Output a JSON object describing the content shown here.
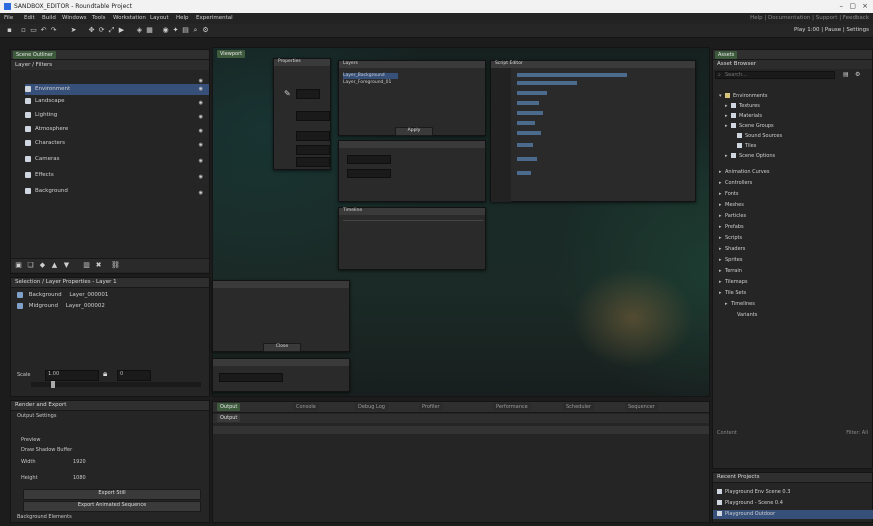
{
  "window": {
    "title": "SANDBOX_EDITOR - Roundtable Project"
  },
  "menu": [
    "File",
    "Edit",
    "Build",
    "Windows",
    "Tools",
    "Workstation",
    "Layout",
    "Help",
    "Experimental"
  ],
  "menu_right": "Help | Documentation | Support | Feedback",
  "toolbar": {
    "right_text": "Play 1:00 | Pause | Settings"
  },
  "scene_panel": {
    "tab": "Scene Outliner",
    "header": "Layer / Filters",
    "items": [
      "Environment",
      "Landscape",
      "Lighting",
      "Atmosphere",
      "Characters",
      "Cameras",
      "Effects",
      "Background"
    ],
    "selected_index": 0
  },
  "props_panel": {
    "title": "Selection / Layer Properties - Layer 1",
    "rows": [
      {
        "name": "Background",
        "value": "Layer_000001"
      },
      {
        "name": "Midground",
        "value": "Layer_000002"
      }
    ],
    "scale_label": "Scale",
    "scale_value": "1.00",
    "offset_value": "0"
  },
  "render_panel": {
    "title": "Render and Export",
    "section": "Output Settings",
    "options": [
      "Preview",
      "Draw Shadow Buffer"
    ],
    "width_label": "Width",
    "width_value": "1920",
    "height_label": "Height",
    "height_value": "1080",
    "button1": "Export Still",
    "button2": "Export Animated Sequence",
    "footer": "Background Elements"
  },
  "viewport": {
    "tab": "Viewport"
  },
  "floating": {
    "props_title": "Properties",
    "list_title": "Layers",
    "list_items": [
      "Layer_Background",
      "Layer_Foreground_01"
    ],
    "list_button": "Apply",
    "code_title": "Script Editor",
    "timeline_title": "Timeline",
    "small_panel_button": "Close"
  },
  "bottom_panel": {
    "tabs": [
      "Output",
      "Console",
      "Debug Log",
      "Profiler",
      "Performance",
      "Scheduler",
      "Sequencer"
    ],
    "sub_tab": "Output"
  },
  "assets_panel": {
    "tab": "Assets",
    "header": "Asset Browser",
    "search_placeholder": "Search...",
    "tree": [
      "Environments",
      "Textures",
      "Materials",
      "Scene Groups",
      "Sound Sources",
      "Tiles",
      "Scene Options",
      "Animation Curves",
      "Controllers",
      "Fonts",
      "Meshes",
      "Particles",
      "Prefabs",
      "Scripts",
      "Shaders",
      "Sprites",
      "Terrain",
      "Tilemaps",
      "Tile Sets",
      "Timelines",
      "Variants"
    ],
    "footer_left": "Content",
    "footer_right": "Filter: All"
  },
  "recent_panel": {
    "title": "Recent Projects",
    "items": [
      "Playground Env Scene 0.3",
      "Playground - Scene 0.4",
      "Playground Outdoor"
    ],
    "selected_index": 2
  }
}
